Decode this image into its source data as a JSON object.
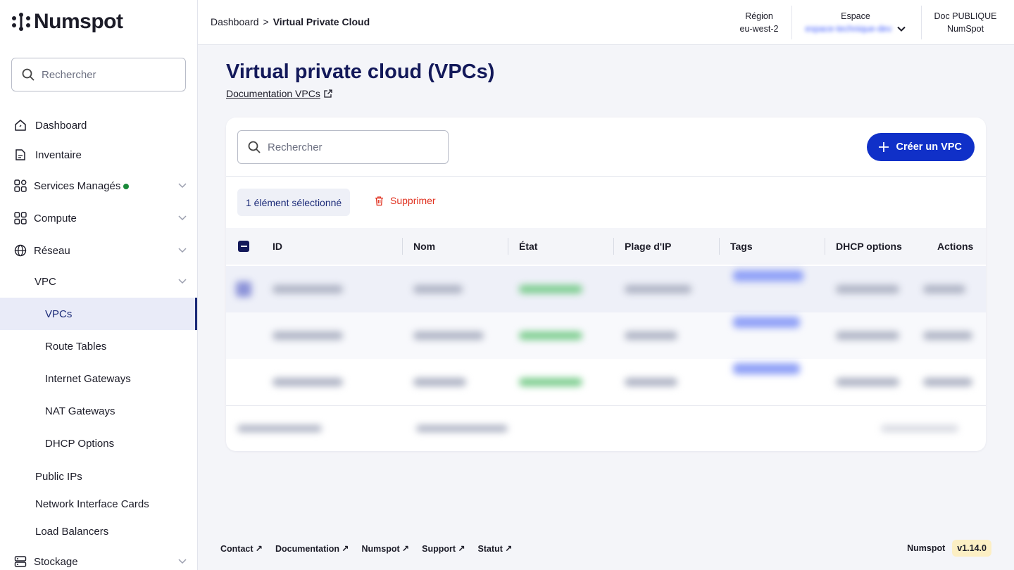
{
  "brand": {
    "name": "Numspot"
  },
  "sidebar": {
    "search_placeholder": "Rechercher",
    "items": [
      {
        "label": "Dashboard",
        "icon": "home-icon"
      },
      {
        "label": "Inventaire",
        "icon": "document-icon"
      },
      {
        "label": "Services Managés",
        "icon": "services-icon"
      },
      {
        "label": "Compute",
        "icon": "grid-icon"
      },
      {
        "label": "Réseau",
        "icon": "globe-icon"
      },
      {
        "label": "VPC"
      },
      {
        "label": "VPCs"
      },
      {
        "label": "Route Tables"
      },
      {
        "label": "Internet Gateways"
      },
      {
        "label": "NAT Gateways"
      },
      {
        "label": "DHCP Options"
      },
      {
        "label": "Public IPs"
      },
      {
        "label": "Network Interface Cards"
      },
      {
        "label": "Load Balancers"
      },
      {
        "label": "Stockage",
        "icon": "storage-icon"
      }
    ]
  },
  "topbar": {
    "breadcrumb_root": "Dashboard",
    "breadcrumb_sep": ">",
    "breadcrumb_current": "Virtual Private Cloud",
    "region_label": "Région",
    "region_value": "eu-west-2",
    "espace_label": "Espace",
    "espace_value": "espace-technique-dev",
    "doc_label": "Doc PUBLIQUE",
    "doc_value": "NumSpot"
  },
  "main": {
    "title": "Virtual private cloud (VPCs)",
    "doc_link": "Documentation VPCs",
    "search_placeholder": "Rechercher",
    "create_button": "Créer un VPC",
    "selection_chip": "1 élément sélectionné",
    "delete_button": "Supprimer",
    "columns": [
      "ID",
      "Nom",
      "État",
      "Plage d'IP",
      "Tags",
      "DHCP options",
      "Actions"
    ]
  },
  "footer": {
    "links": [
      "Contact",
      "Documentation",
      "Numspot",
      "Support",
      "Statut"
    ],
    "company": "Numspot",
    "version": "v1.14.0"
  },
  "colors": {
    "primary": "#1030c8",
    "title": "#13195a",
    "danger": "#e0301e",
    "success": "#1a8a3a",
    "version_bg": "#fcefc4"
  }
}
